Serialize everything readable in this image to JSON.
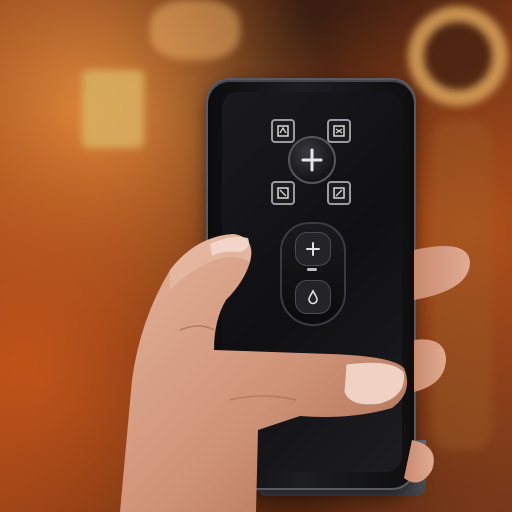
{
  "scene": {
    "subject": "remote-control-in-hand",
    "colors": {
      "background_warm": "#8a3a14",
      "remote_body": "#121215",
      "button_outline": "#9a9aa0",
      "skin": "#d79f86"
    },
    "remote": {
      "top_buttons": [
        {
          "name": "top-left-button",
          "icon": "square-glyph-icon"
        },
        {
          "name": "top-right-button",
          "icon": "square-glyph-icon"
        }
      ],
      "center_button": {
        "icon": "plus-icon"
      },
      "bottom_buttons": [
        {
          "name": "bottom-left-button",
          "icon": "square-glyph-icon"
        },
        {
          "name": "bottom-right-button",
          "icon": "square-glyph-icon"
        }
      ],
      "lower_pad": {
        "buttons": [
          {
            "name": "lower-plus-button",
            "icon": "plus-icon"
          },
          {
            "name": "lower-drop-button",
            "icon": "drop-icon"
          }
        ]
      }
    }
  }
}
